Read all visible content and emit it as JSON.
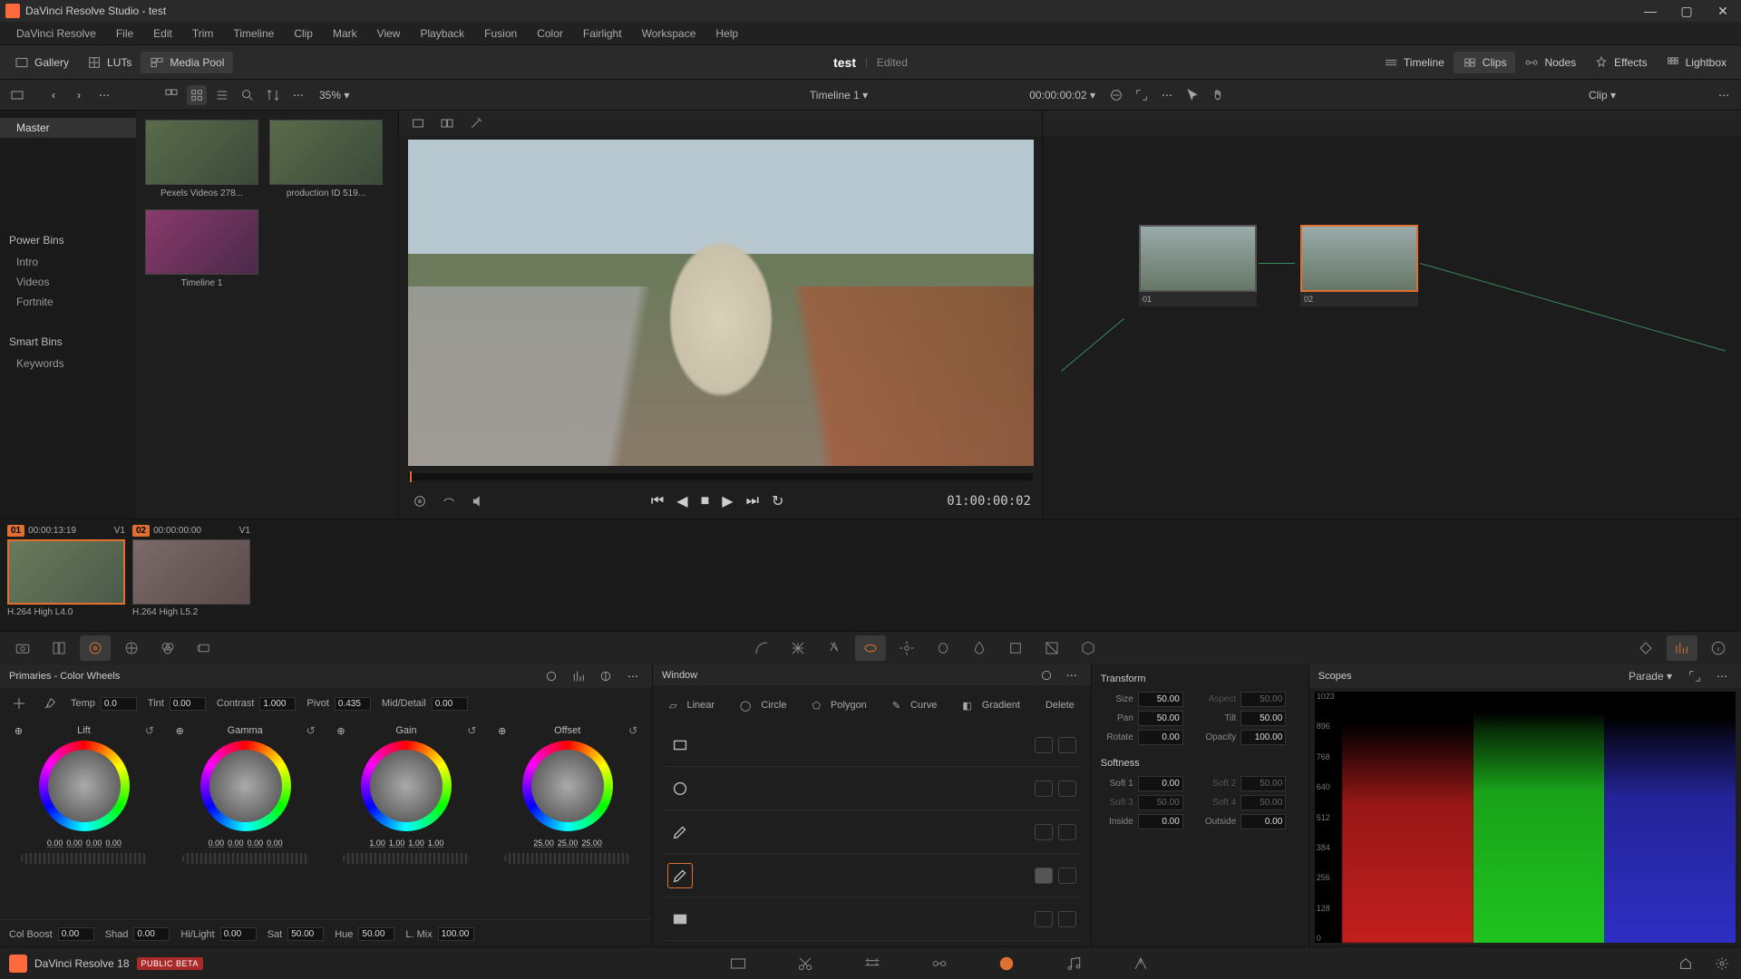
{
  "app": {
    "title": "DaVinci Resolve Studio - test"
  },
  "menu": [
    "DaVinci Resolve",
    "File",
    "Edit",
    "Trim",
    "Timeline",
    "Clip",
    "Mark",
    "View",
    "Playback",
    "Fusion",
    "Color",
    "Fairlight",
    "Workspace",
    "Help"
  ],
  "toolbar": {
    "gallery": "Gallery",
    "luts": "LUTs",
    "mediapool": "Media Pool",
    "timeline": "Timeline",
    "clips": "Clips",
    "nodes": "Nodes",
    "effects": "Effects",
    "lightbox": "Lightbox",
    "project": "test",
    "edited": "Edited"
  },
  "secondbar": {
    "zoom": "35%",
    "timeline_name": "Timeline 1",
    "timecode_left": "00:00:00:02",
    "node_mode": "Clip"
  },
  "mediapool": {
    "master": "Master",
    "powerbins_hdr": "Power Bins",
    "powerbins": [
      "Intro",
      "Videos",
      "Fortnite"
    ],
    "smartbins_hdr": "Smart Bins",
    "smartbins": [
      "Keywords"
    ],
    "thumbs": [
      {
        "name": "Pexels Videos 278..."
      },
      {
        "name": "production ID 519..."
      },
      {
        "name": "Timeline 1",
        "timeline": true
      }
    ]
  },
  "viewer": {
    "timecode": "01:00:00:02"
  },
  "nodes": {
    "n1": "01",
    "n2": "02"
  },
  "clipstrip": [
    {
      "num": "01",
      "tc": "00:00:13:19",
      "track": "V1",
      "codec": "H.264 High L4.0",
      "sel": true
    },
    {
      "num": "02",
      "tc": "00:00:00:00",
      "track": "V1",
      "codec": "H.264 High L5.2",
      "sel": false
    }
  ],
  "primaries": {
    "title": "Primaries - Color Wheels",
    "sliders": {
      "temp_l": "Temp",
      "temp": "0.0",
      "tint_l": "Tint",
      "tint": "0.00",
      "contrast_l": "Contrast",
      "contrast": "1.000",
      "pivot_l": "Pivot",
      "pivot": "0.435",
      "md_l": "Mid/Detail",
      "md": "0.00"
    },
    "wheels": {
      "lift": {
        "label": "Lift",
        "vals": [
          "0.00",
          "0.00",
          "0.00",
          "0.00"
        ]
      },
      "gamma": {
        "label": "Gamma",
        "vals": [
          "0.00",
          "0.00",
          "0.00",
          "0.00"
        ]
      },
      "gain": {
        "label": "Gain",
        "vals": [
          "1.00",
          "1.00",
          "1.00",
          "1.00"
        ]
      },
      "offset": {
        "label": "Offset",
        "vals": [
          "25.00",
          "25.00",
          "25.00"
        ]
      }
    },
    "bottom": {
      "colboost_l": "Col Boost",
      "colboost": "0.00",
      "shad_l": "Shad",
      "shad": "0.00",
      "hilight_l": "Hi/Light",
      "hilight": "0.00",
      "sat_l": "Sat",
      "sat": "50.00",
      "hue_l": "Hue",
      "hue": "50.00",
      "lmix_l": "L. Mix",
      "lmix": "100.00"
    }
  },
  "window": {
    "title": "Window",
    "tools": {
      "linear": "Linear",
      "circle": "Circle",
      "polygon": "Polygon",
      "curve": "Curve",
      "gradient": "Gradient",
      "delete": "Delete"
    }
  },
  "transform": {
    "hdr": "Transform",
    "size_l": "Size",
    "size": "50.00",
    "aspect_l": "Aspect",
    "aspect": "50.00",
    "pan_l": "Pan",
    "pan": "50.00",
    "tilt_l": "Tilt",
    "tilt": "50.00",
    "rotate_l": "Rotate",
    "rotate": "0.00",
    "opacity_l": "Opacity",
    "opacity": "100.00",
    "soft_hdr": "Softness",
    "s1_l": "Soft 1",
    "s1": "0.00",
    "s2_l": "Soft 2",
    "s2": "50.00",
    "s3_l": "Soft 3",
    "s3": "50.00",
    "s4_l": "Soft 4",
    "s4": "50.00",
    "inside_l": "Inside",
    "inside": "0.00",
    "outside_l": "Outside",
    "outside": "0.00"
  },
  "scopes": {
    "title": "Scopes",
    "mode": "Parade",
    "ticks": [
      "1023",
      "896",
      "768",
      "640",
      "512",
      "384",
      "256",
      "128",
      "0"
    ]
  },
  "footer": {
    "version": "DaVinci Resolve 18",
    "beta": "PUBLIC BETA"
  }
}
